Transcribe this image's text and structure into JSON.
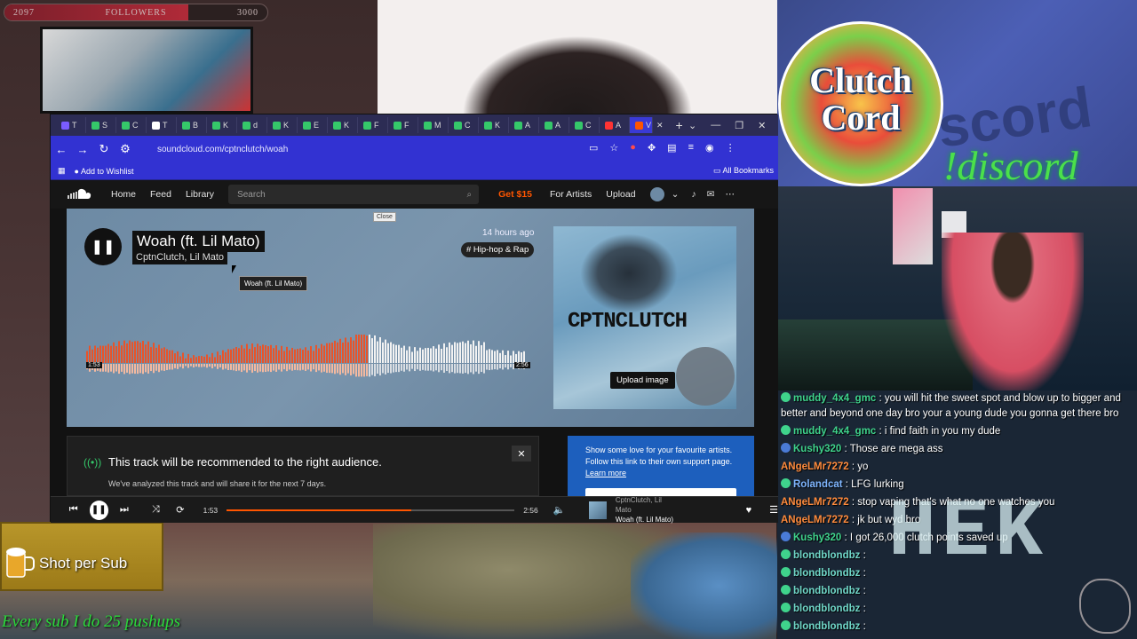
{
  "stream": {
    "followers_bar": {
      "current": "2097",
      "label": "FOLLOWERS",
      "goal": "3000",
      "progress": 0.699
    },
    "clutch_cord": {
      "line1": "Clutch",
      "line2": "Cord"
    },
    "discord_background_word": "scord",
    "discord_command": "!discord",
    "shot_per_sub": "Shot per Sub",
    "pushups_text": "Every sub I do 25 pushups",
    "overlay_word": "HEK"
  },
  "browser": {
    "tabs": [
      {
        "label": "T",
        "color": "#7a5cff"
      },
      {
        "label": "S",
        "color": "#35c86a"
      },
      {
        "label": "C",
        "color": "#35c86a"
      },
      {
        "label": "T",
        "color": "#ffffff"
      },
      {
        "label": "B",
        "color": "#35c86a"
      },
      {
        "label": "K",
        "color": "#35c86a"
      },
      {
        "label": "d",
        "color": "#35c86a"
      },
      {
        "label": "K",
        "color": "#35c86a"
      },
      {
        "label": "E",
        "color": "#35c86a"
      },
      {
        "label": "K",
        "color": "#35c86a"
      },
      {
        "label": "F",
        "color": "#35c86a"
      },
      {
        "label": "F",
        "color": "#35c86a"
      },
      {
        "label": "M",
        "color": "#35c86a"
      },
      {
        "label": "C",
        "color": "#35c86a"
      },
      {
        "label": "K",
        "color": "#35c86a"
      },
      {
        "label": "A",
        "color": "#35c86a"
      },
      {
        "label": "A",
        "color": "#35c86a"
      },
      {
        "label": "C",
        "color": "#35c86a"
      },
      {
        "label": "A",
        "color": "#ff3333"
      },
      {
        "label": "V",
        "color": "#ff5500"
      }
    ],
    "url": "soundcloud.com/cptnclutch/woah",
    "bookmark": "Add to Wishlist",
    "all_bookmarks": "All Bookmarks"
  },
  "soundcloud": {
    "nav": {
      "home": "Home",
      "feed": "Feed",
      "library": "Library",
      "search_placeholder": "Search",
      "get": "Get $15",
      "for_artists": "For Artists",
      "upload": "Upload"
    },
    "track": {
      "title": "Woah (ft. Lil Mato)",
      "artist": "CptnClutch, Lil Mato",
      "posted": "14 hours ago",
      "genre": "# Hip-hop & Rap",
      "elapsed": "1:53",
      "duration": "2:56",
      "progress": 0.642,
      "close_tooltip": "Close",
      "hover_tooltip": "Woah (ft. Lil Mato)",
      "artwork_text": "CPTNCLUTCH",
      "upload_image": "Upload image"
    },
    "recommend": {
      "title": "This track will be recommended to the right audience.",
      "sub": "We've analyzed this track and will share it for the next 7 days."
    },
    "support": {
      "text": "Show some love for your favourite artists. Follow this link to their own support page.",
      "link": "Learn more"
    },
    "player": {
      "elapsed": "1:53",
      "duration": "2:56",
      "artist": "CptnClutch, Lil Mato",
      "title": "Woah (ft. Lil Mato)",
      "progress": 0.642
    }
  },
  "chat": [
    {
      "user": "muddy_4x4_gmc",
      "color": "green",
      "badge": "#3fd38c",
      "msg": " : you will hit the sweet spot and blow up to bigger and better and beyond one day bro your a young dude you gonna get there bro",
      "lines": 2
    },
    {
      "user": "muddy_4x4_gmc",
      "color": "green",
      "badge": "#3fd38c",
      "msg": " : i find faith in you my dude",
      "lines": 1
    },
    {
      "user": "Kushy320",
      "color": "green",
      "badge": "#4a7bd6",
      "msg": " : Those are mega ass",
      "lines": 1
    },
    {
      "user": "ANgeLMr7272",
      "color": "orange",
      "badge": "",
      "msg": " : yo",
      "lines": 1
    },
    {
      "user": "Rolandcat",
      "color": "blue",
      "badge": "#3fd38c",
      "msg": " : LFG  lurking",
      "lines": 1
    },
    {
      "user": "ANgeLMr7272",
      "color": "orange",
      "badge": "",
      "msg": " : stop vaping that's what no one watches you",
      "lines": 1
    },
    {
      "user": "ANgeLMr7272",
      "color": "orange",
      "badge": "",
      "msg": " : jk but wyd bro",
      "lines": 1
    },
    {
      "user": "Kushy320",
      "color": "green",
      "badge": "#4a7bd6",
      "msg": " : I got 26,000 clutch points saved up",
      "lines": 1
    },
    {
      "user": "blondblondbz",
      "color": "teal",
      "badge": "#3fd38c",
      "msg": " :",
      "lines": 1
    },
    {
      "user": "blondblondbz",
      "color": "teal",
      "badge": "#3fd38c",
      "msg": " :",
      "lines": 1
    },
    {
      "user": "blondblondbz",
      "color": "teal",
      "badge": "#3fd38c",
      "msg": " :",
      "lines": 1
    },
    {
      "user": "blondblondbz",
      "color": "teal",
      "badge": "#3fd38c",
      "msg": " :",
      "lines": 1
    },
    {
      "user": "blondblondbz",
      "color": "teal",
      "badge": "#3fd38c",
      "msg": " :",
      "lines": 1
    }
  ]
}
